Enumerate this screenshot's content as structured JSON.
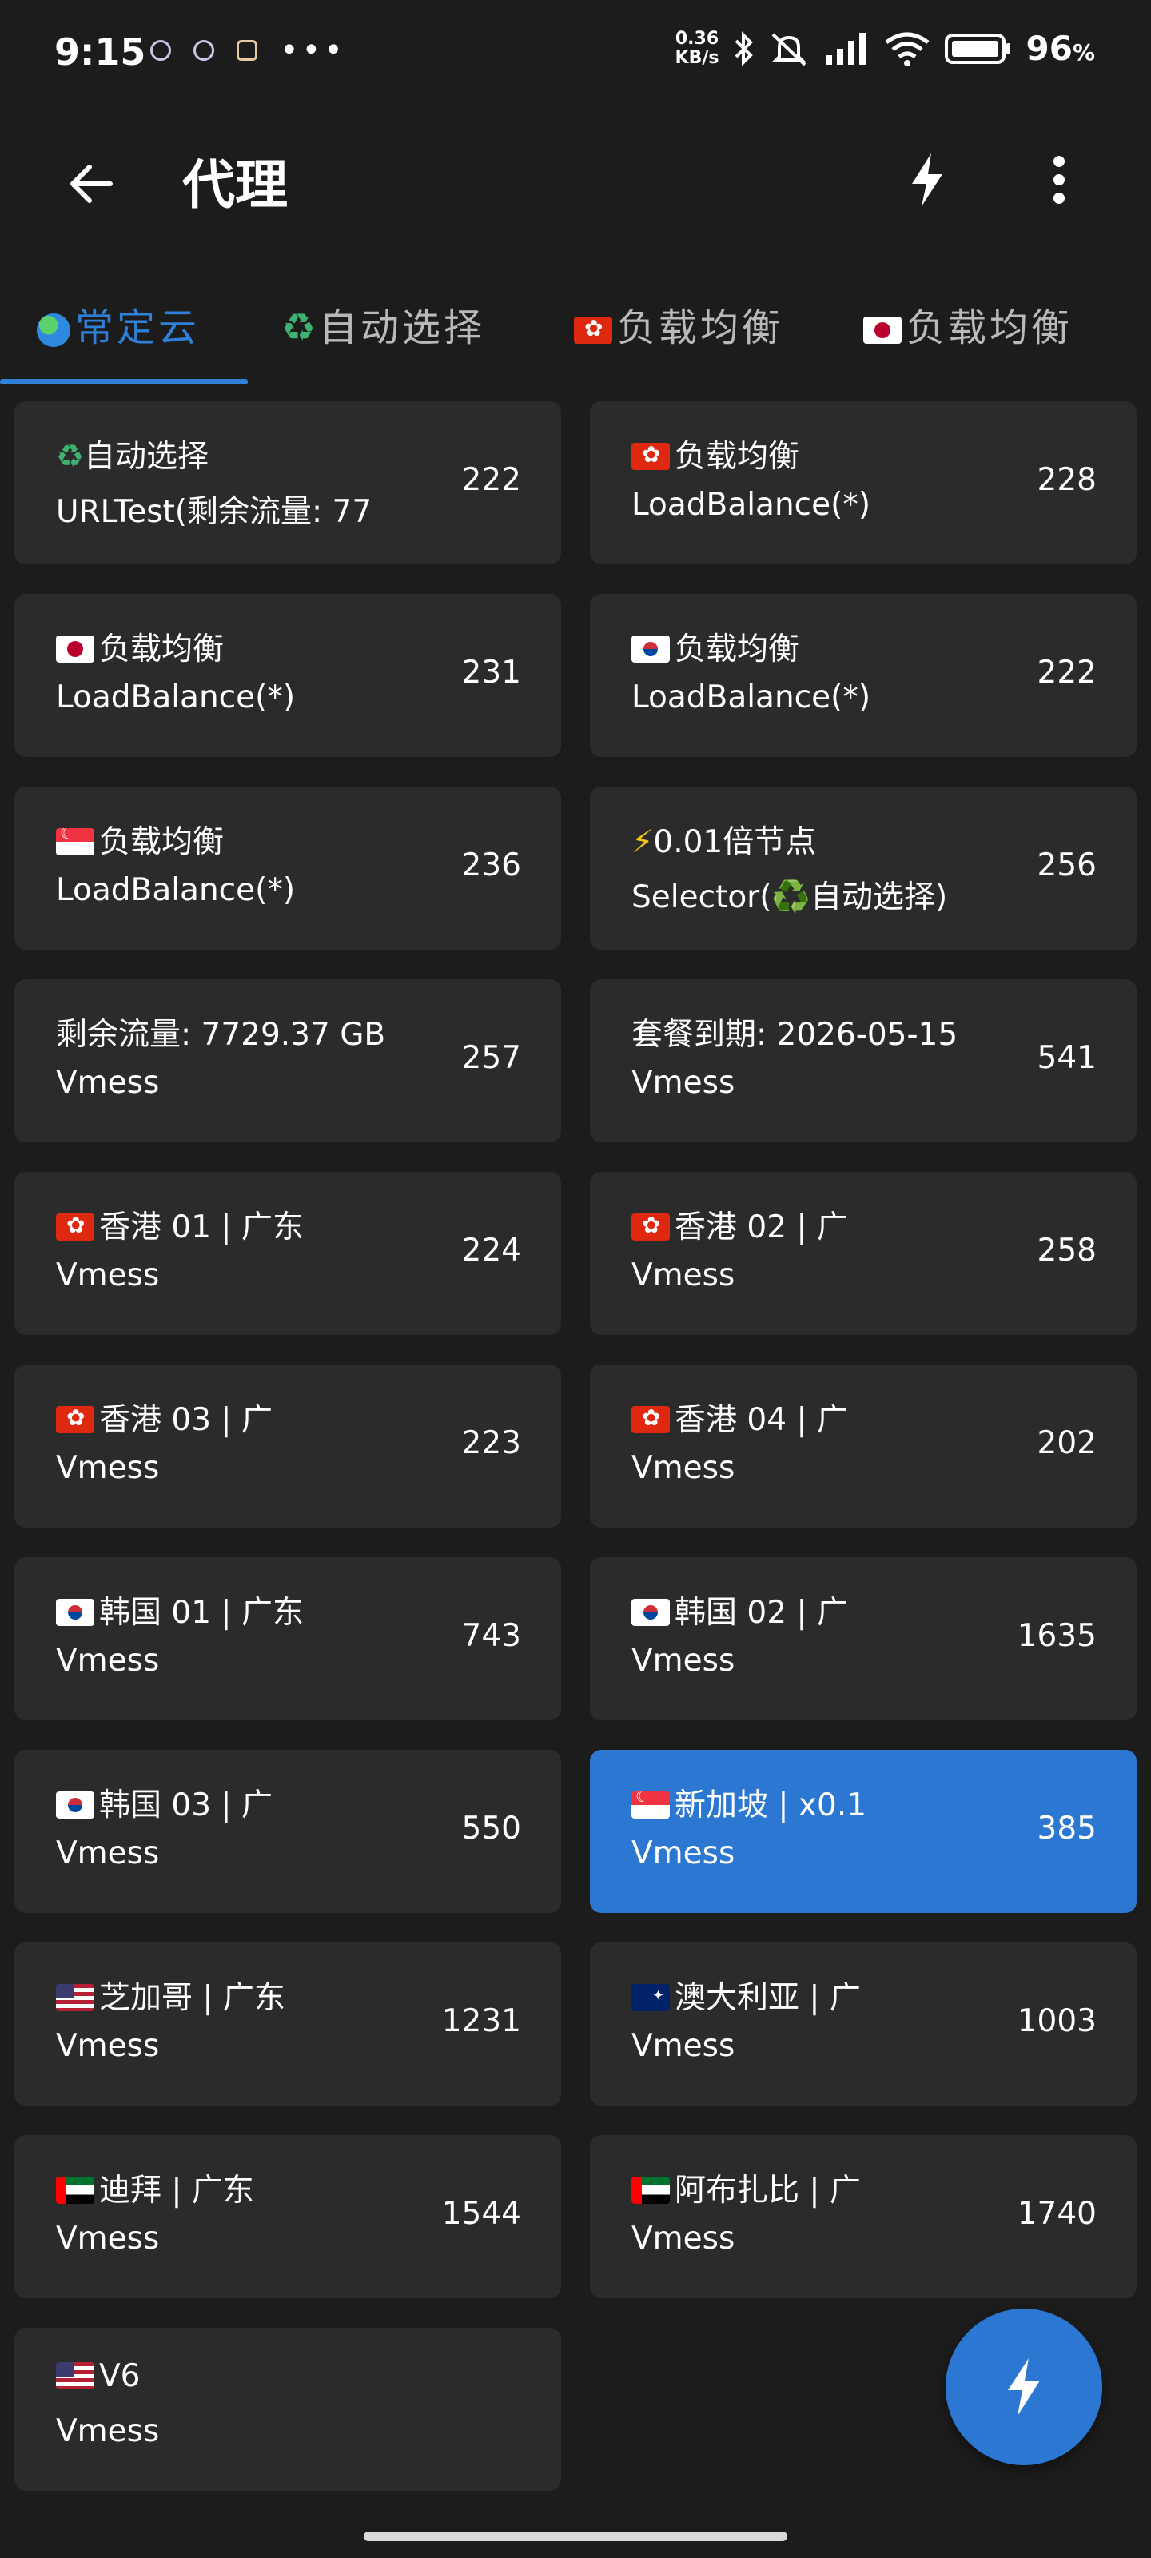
{
  "status_bar": {
    "time": "9:15",
    "net_speed_value": "0.36",
    "net_speed_unit": "KB/s",
    "battery": "96",
    "battery_unit": "%",
    "icons": [
      "bluetooth-icon",
      "mute-icon",
      "signal-icon",
      "wifi-icon",
      "battery-icon"
    ]
  },
  "app_bar": {
    "title": "代理",
    "actions": [
      "back-arrow-icon",
      "bolt-icon",
      "more-vert-icon"
    ]
  },
  "tabs": [
    {
      "label": "常定云",
      "icon": "globe",
      "active": true
    },
    {
      "label": "自动选择",
      "icon": "recycle",
      "active": false
    },
    {
      "label": "负载均衡",
      "icon": "flag-hk",
      "active": false
    },
    {
      "label": "负载均衡",
      "icon": "flag-jp",
      "active": false
    }
  ],
  "proxies": [
    {
      "icon": "recycle",
      "name": "自动选择",
      "type": "URLTest(剩余流量: 77",
      "delay": "222",
      "selected": false
    },
    {
      "icon": "flag-hk",
      "name": "负载均衡",
      "type": "LoadBalance(*)",
      "delay": "228",
      "selected": false
    },
    {
      "icon": "flag-jp",
      "name": "负载均衡",
      "type": "LoadBalance(*)",
      "delay": "231",
      "selected": false
    },
    {
      "icon": "flag-kr",
      "name": "负载均衡",
      "type": "LoadBalance(*)",
      "delay": "222",
      "selected": false
    },
    {
      "icon": "flag-sg",
      "name": "负载均衡",
      "type": "LoadBalance(*)",
      "delay": "236",
      "selected": false
    },
    {
      "icon": "bolt",
      "name": "0.01倍节点",
      "type": "Selector(♻️自动选择)",
      "delay": "256",
      "selected": false
    },
    {
      "icon": "",
      "name": "剩余流量: 7729.37 GB",
      "type": "Vmess",
      "delay": "257",
      "selected": false
    },
    {
      "icon": "",
      "name": "套餐到期: 2026-05-15",
      "type": "Vmess",
      "delay": "541",
      "selected": false
    },
    {
      "icon": "flag-hk",
      "name": "香港 01 | 广东",
      "type": "Vmess",
      "delay": "224",
      "selected": false
    },
    {
      "icon": "flag-hk",
      "name": "香港 02 | 广",
      "type": "Vmess",
      "delay": "258",
      "selected": false
    },
    {
      "icon": "flag-hk",
      "name": "香港 03 | 广",
      "type": "Vmess",
      "delay": "223",
      "selected": false
    },
    {
      "icon": "flag-hk",
      "name": "香港 04 | 广",
      "type": "Vmess",
      "delay": "202",
      "selected": false
    },
    {
      "icon": "flag-kr",
      "name": "韩国 01 | 广东",
      "type": "Vmess",
      "delay": "743",
      "selected": false
    },
    {
      "icon": "flag-kr",
      "name": "韩国 02 | 广",
      "type": "Vmess",
      "delay": "1635",
      "selected": false
    },
    {
      "icon": "flag-kr",
      "name": "韩国 03 | 广",
      "type": "Vmess",
      "delay": "550",
      "selected": false
    },
    {
      "icon": "flag-sg",
      "name": "新加坡 | x0.1",
      "type": "Vmess",
      "delay": "385",
      "selected": true
    },
    {
      "icon": "flag-us",
      "name": "芝加哥 | 广东",
      "type": "Vmess",
      "delay": "1231",
      "selected": false
    },
    {
      "icon": "flag-au",
      "name": "澳大利亚 | 广",
      "type": "Vmess",
      "delay": "1003",
      "selected": false
    },
    {
      "icon": "flag-ae",
      "name": "迪拜 | 广东",
      "type": "Vmess",
      "delay": "1544",
      "selected": false
    },
    {
      "icon": "flag-ae",
      "name": "阿布扎比 | 广",
      "type": "Vmess",
      "delay": "1740",
      "selected": false
    },
    {
      "icon": "flag-us",
      "name": "V6",
      "type": "Vmess",
      "delay": "",
      "selected": false
    }
  ],
  "colors": {
    "background": "#1c1c1c",
    "card": "#2b2b2b",
    "accent": "#2b77d1",
    "tab_active": "#2f80d8"
  },
  "fab": {
    "icon": "bolt-icon"
  }
}
